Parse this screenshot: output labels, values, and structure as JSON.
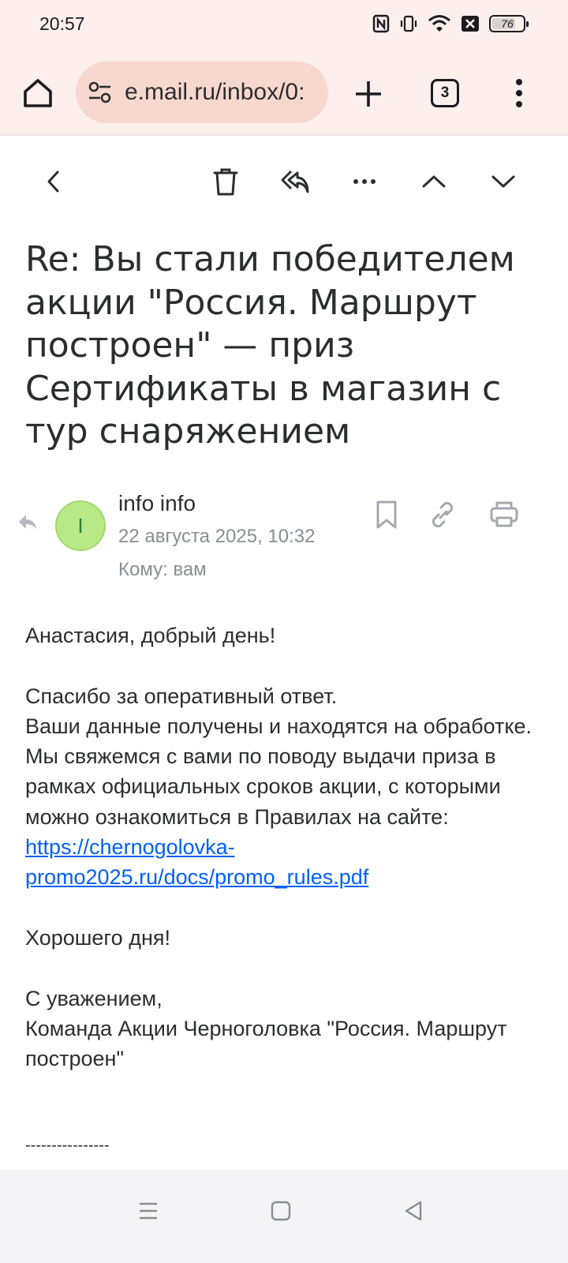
{
  "status_bar": {
    "time": "20:57",
    "battery": "76",
    "icons": [
      "nfc-icon",
      "vibrate-icon",
      "wifi-icon",
      "notification-x-icon",
      "battery-icon"
    ]
  },
  "browser": {
    "url": "e.mail.ru/inbox/0:",
    "tab_count": "3",
    "icons": [
      "home-icon",
      "site-settings-icon",
      "plus-icon",
      "tabs-icon",
      "more-vertical-icon"
    ]
  },
  "toolbar": {
    "icons": [
      "back-icon",
      "trash-icon",
      "reply-all-icon",
      "more-horizontal-icon",
      "previous-icon",
      "next-icon"
    ]
  },
  "email": {
    "subject": "Re: Вы стали победителем акции \"Россия. Маршрут построен\" — приз Сертификаты в магазин с тур снаряжением",
    "avatar_letter": "I",
    "sender": "info info",
    "date": "22 августа 2025, 10:32",
    "to": "Кому: вам",
    "greeting": "Анастасия, добрый день!",
    "para1_line1": "Спасибо за оперативный ответ.",
    "para1_text": "Ваши данные получены и находятся на обработке. Мы свяжемся с вами по поводу выдачи приза в рамках официальных сроков акции, с которыми можно ознакомиться в Правилах на сайте: ",
    "link": "https://chernogolovka-promo2025.ru/docs/promo_rules.pdf",
    "closing": "Хорошего дня!",
    "sign1": "С уважением,",
    "sign2": "Команда Акции Черноголовка \"Россия. Маршрут построен\"",
    "divider": "----------------"
  },
  "colors": {
    "browser_bg": "#fdf0ec",
    "url_pill": "#f7d8cf",
    "link": "#005ff9",
    "avatar": "#b8e986"
  }
}
